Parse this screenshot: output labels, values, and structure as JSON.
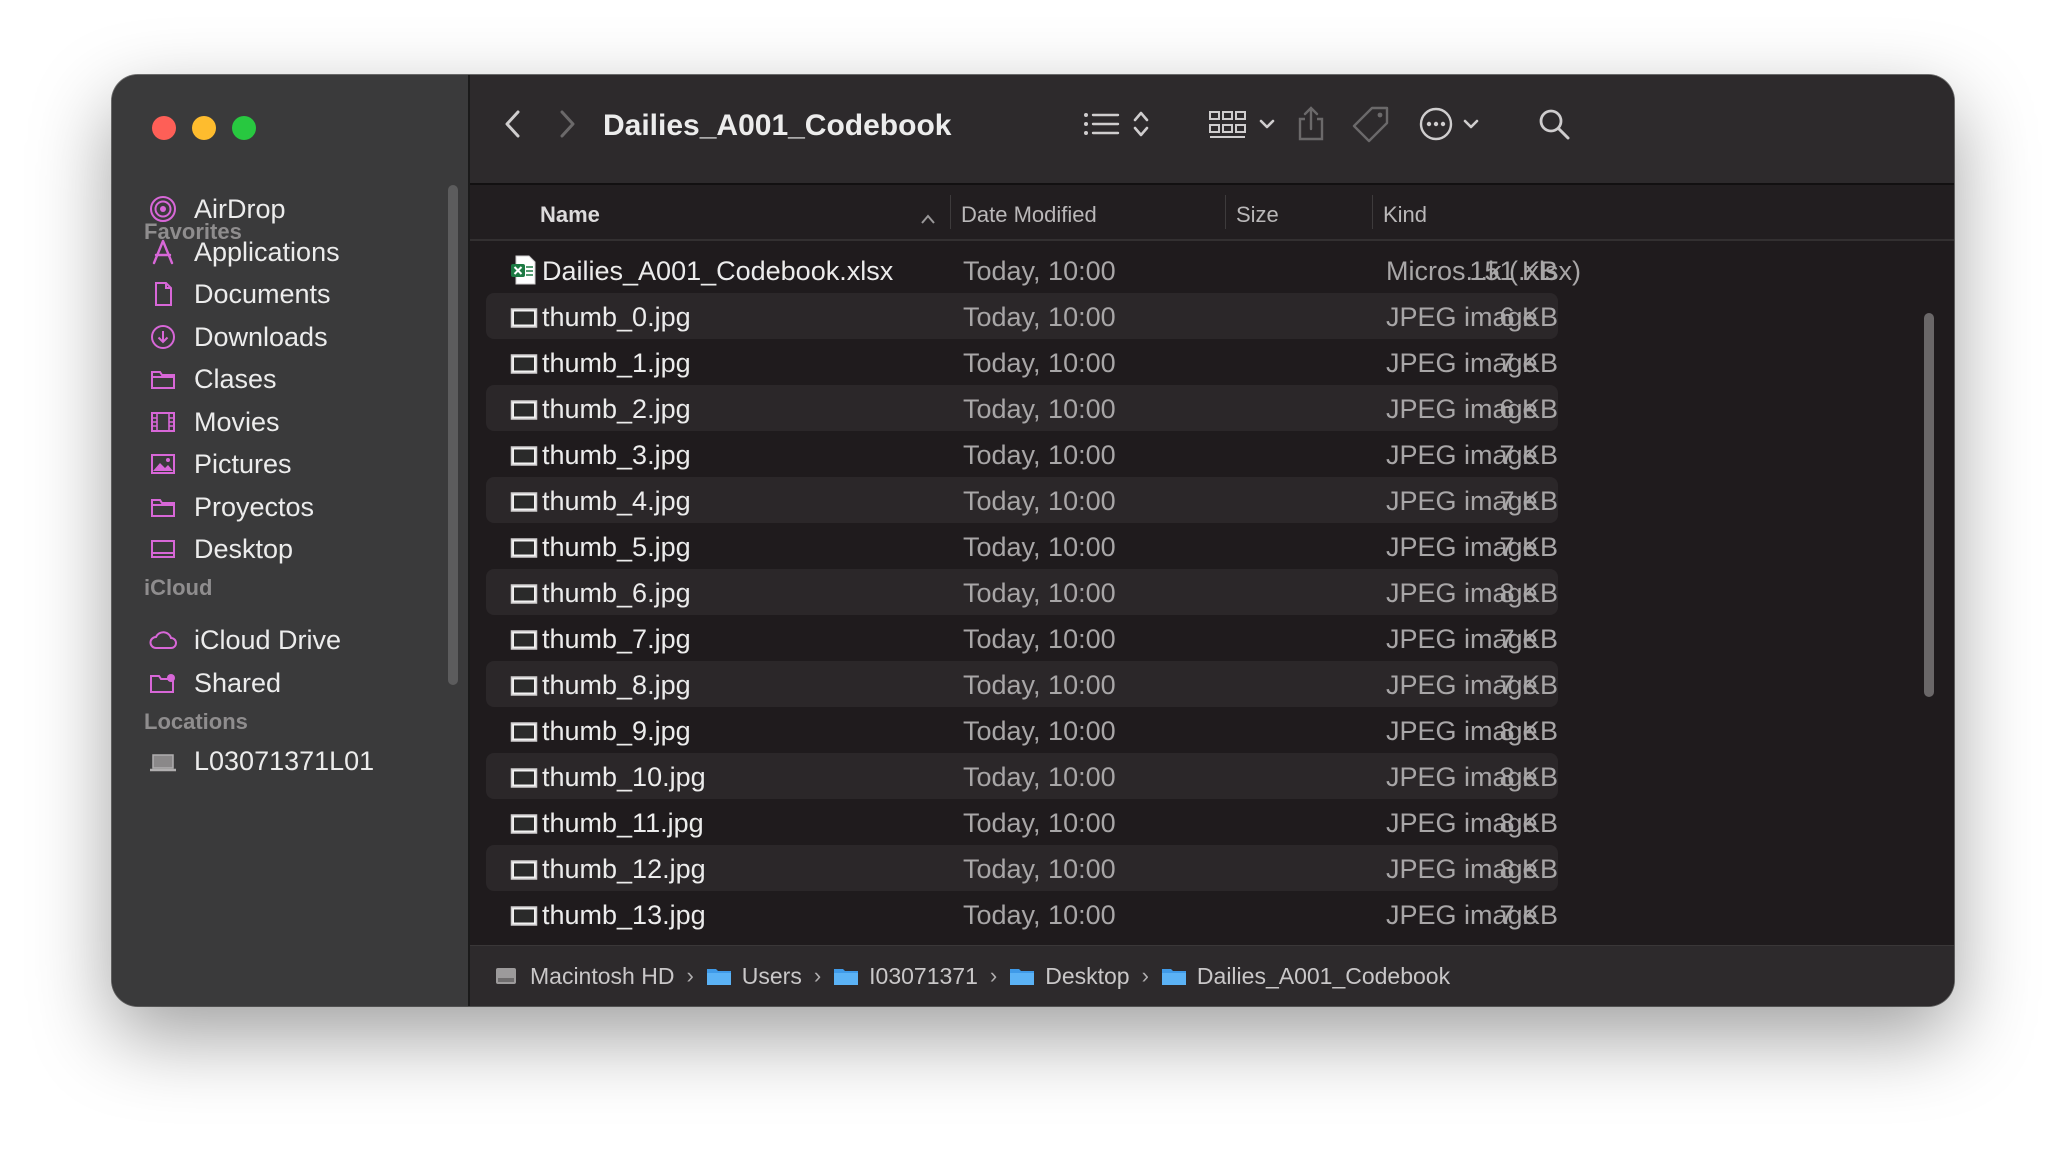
{
  "window": {
    "title": "Dailies_A001_Codebook"
  },
  "sidebar": {
    "sections": [
      {
        "header": "Favorites",
        "items": [
          {
            "label": "AirDrop",
            "icon": "airdrop-icon"
          },
          {
            "label": "Applications",
            "icon": "applications-icon"
          },
          {
            "label": "Documents",
            "icon": "document-icon"
          },
          {
            "label": "Downloads",
            "icon": "download-icon"
          },
          {
            "label": "Clases",
            "icon": "folder-icon"
          },
          {
            "label": "Movies",
            "icon": "film-icon"
          },
          {
            "label": "Pictures",
            "icon": "photo-icon"
          },
          {
            "label": "Proyectos",
            "icon": "folder-icon"
          },
          {
            "label": "Desktop",
            "icon": "desktop-icon"
          }
        ]
      },
      {
        "header": "iCloud",
        "items": [
          {
            "label": "iCloud Drive",
            "icon": "cloud-icon"
          },
          {
            "label": "Shared",
            "icon": "shared-folder-icon"
          }
        ]
      },
      {
        "header": "Locations",
        "items": [
          {
            "label": "L03071371L01",
            "icon": "laptop-icon"
          }
        ]
      }
    ],
    "accent_color": "#d867d8"
  },
  "toolbar": {
    "back_icon": "chevron-left-icon",
    "forward_icon": "chevron-right-icon",
    "view_icon": "list-view-icon",
    "group_icon": "grid-view-icon",
    "share_icon": "share-icon",
    "tag_icon": "tag-icon",
    "more_icon": "ellipsis-circle-icon",
    "search_icon": "search-icon"
  },
  "columns": {
    "name": "Name",
    "date": "Date Modified",
    "size": "Size",
    "kind": "Kind"
  },
  "files": [
    {
      "name": "Dailies_A001_Codebook.xlsx",
      "date": "Today, 10:00",
      "size": "151 KB",
      "kind": "Micros...k (.xlsx)",
      "type": "excel"
    },
    {
      "name": "thumb_0.jpg",
      "date": "Today, 10:00",
      "size": "6 KB",
      "kind": "JPEG image",
      "type": "image"
    },
    {
      "name": "thumb_1.jpg",
      "date": "Today, 10:00",
      "size": "7 KB",
      "kind": "JPEG image",
      "type": "image"
    },
    {
      "name": "thumb_2.jpg",
      "date": "Today, 10:00",
      "size": "6 KB",
      "kind": "JPEG image",
      "type": "image"
    },
    {
      "name": "thumb_3.jpg",
      "date": "Today, 10:00",
      "size": "7 KB",
      "kind": "JPEG image",
      "type": "image"
    },
    {
      "name": "thumb_4.jpg",
      "date": "Today, 10:00",
      "size": "7 KB",
      "kind": "JPEG image",
      "type": "image"
    },
    {
      "name": "thumb_5.jpg",
      "date": "Today, 10:00",
      "size": "7 KB",
      "kind": "JPEG image",
      "type": "image"
    },
    {
      "name": "thumb_6.jpg",
      "date": "Today, 10:00",
      "size": "8 KB",
      "kind": "JPEG image",
      "type": "image"
    },
    {
      "name": "thumb_7.jpg",
      "date": "Today, 10:00",
      "size": "7 KB",
      "kind": "JPEG image",
      "type": "image"
    },
    {
      "name": "thumb_8.jpg",
      "date": "Today, 10:00",
      "size": "7 KB",
      "kind": "JPEG image",
      "type": "image"
    },
    {
      "name": "thumb_9.jpg",
      "date": "Today, 10:00",
      "size": "8 KB",
      "kind": "JPEG image",
      "type": "image"
    },
    {
      "name": "thumb_10.jpg",
      "date": "Today, 10:00",
      "size": "8 KB",
      "kind": "JPEG image",
      "type": "image"
    },
    {
      "name": "thumb_11.jpg",
      "date": "Today, 10:00",
      "size": "8 KB",
      "kind": "JPEG image",
      "type": "image"
    },
    {
      "name": "thumb_12.jpg",
      "date": "Today, 10:00",
      "size": "8 KB",
      "kind": "JPEG image",
      "type": "image"
    },
    {
      "name": "thumb_13.jpg",
      "date": "Today, 10:00",
      "size": "7 KB",
      "kind": "JPEG image",
      "type": "image"
    }
  ],
  "pathbar": [
    {
      "label": "Macintosh HD",
      "icon": "hard-drive-icon"
    },
    {
      "label": "Users",
      "icon": "folder-icon"
    },
    {
      "label": "I03071371",
      "icon": "home-folder-icon"
    },
    {
      "label": "Desktop",
      "icon": "folder-icon"
    },
    {
      "label": "Dailies_A001_Codebook",
      "icon": "folder-icon"
    }
  ]
}
